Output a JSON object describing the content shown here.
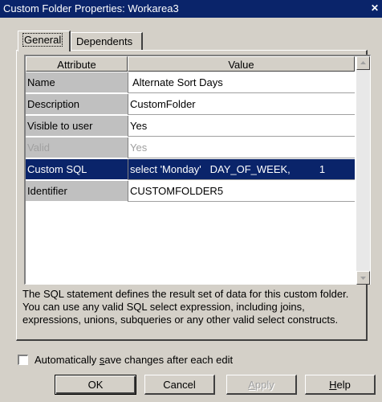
{
  "window": {
    "title": "Custom Folder Properties: Workarea3",
    "close_glyph": "✕"
  },
  "tabs": [
    {
      "label": "General",
      "active": true
    },
    {
      "label": "Dependents",
      "active": false
    }
  ],
  "grid": {
    "columns": [
      "Attribute",
      "Value"
    ],
    "rows": [
      {
        "attribute": "Name",
        "value": "Alternate Sort Days",
        "state": "normal"
      },
      {
        "attribute": "Description",
        "value": "CustomFolder",
        "state": "normal"
      },
      {
        "attribute": "Visible to user",
        "value": "Yes",
        "state": "normal"
      },
      {
        "attribute": "Valid",
        "value": "Yes",
        "state": "disabled"
      },
      {
        "attribute": "Custom SQL",
        "value": "select 'Monday'   DAY_OF_WEEK,          1",
        "state": "selected"
      },
      {
        "attribute": "Identifier",
        "value": "CUSTOMFOLDER5",
        "state": "normal"
      }
    ]
  },
  "description": "The SQL statement defines the result set of data for this custom folder. You can use any valid SQL select expression, including joins, expressions, unions, subqueries or any other valid select constructs.",
  "autosave": {
    "label_pre": "Automatically ",
    "label_u": "s",
    "label_post": "ave changes after each edit",
    "checked": false
  },
  "buttons": {
    "ok": "OK",
    "cancel": "Cancel",
    "apply_u": "A",
    "apply_rest": "pply",
    "help_u": "H",
    "help_rest": "elp"
  },
  "colors": {
    "titlebar": "#0a246a",
    "selection": "#0a246a",
    "face": "#d4d0c8"
  }
}
